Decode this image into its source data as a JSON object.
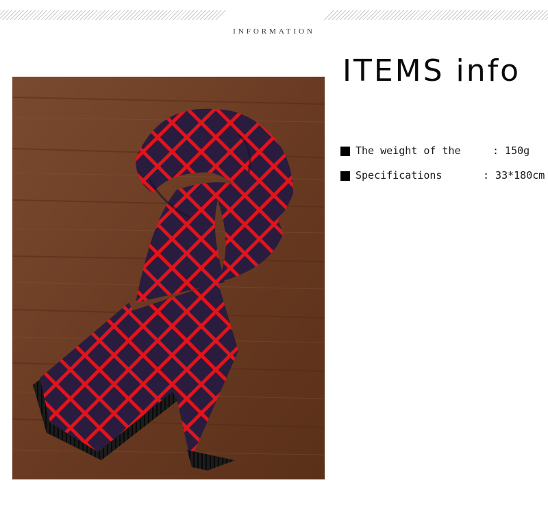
{
  "header": {
    "section_label": "INFORMATION"
  },
  "photo": {
    "subject": "red and navy diamond pattern scarf on wooden table",
    "colors": {
      "wood": "#6e3f27",
      "scarf_base": "#2a1c3e",
      "scarf_pattern": "#e0141c",
      "fringe": "#141414"
    }
  },
  "info": {
    "title": "ITEMS info",
    "specs": [
      {
        "bullet_icon": "square-bullet-icon",
        "label": "The weight of the",
        "value": ": 150g"
      },
      {
        "bullet_icon": "square-bullet-icon",
        "label": "Specifications",
        "value": ": 33*180cm"
      }
    ]
  }
}
